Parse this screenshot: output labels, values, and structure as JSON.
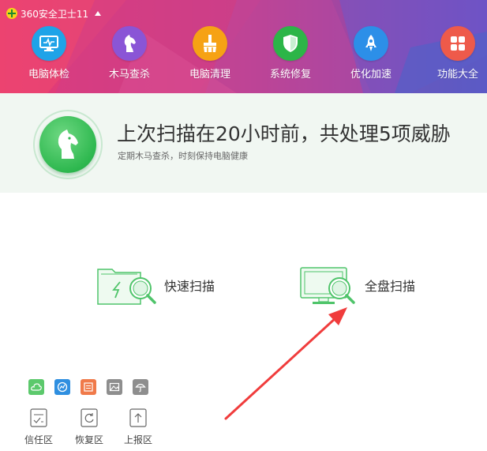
{
  "app": {
    "title": "360安全卫士11"
  },
  "nav": {
    "items": [
      {
        "label": "电脑体检",
        "icon": "monitor-check-icon",
        "color": "#1fa3e8"
      },
      {
        "label": "木马查杀",
        "icon": "horse-icon",
        "color": "#8a55d6"
      },
      {
        "label": "电脑清理",
        "icon": "broom-icon",
        "color": "#f6a214"
      },
      {
        "label": "系统修复",
        "icon": "shield-check-icon",
        "color": "#2cb548"
      },
      {
        "label": "优化加速",
        "icon": "rocket-icon",
        "color": "#2c8fe8"
      },
      {
        "label": "功能大全",
        "icon": "grid-icon",
        "color": "#ee5a4a"
      }
    ]
  },
  "status": {
    "title": "上次扫描在20小时前，共处理5项威胁",
    "subtitle": "定期木马查杀，时刻保持电脑健康"
  },
  "scan": {
    "quick_label": "快速扫描",
    "full_label": "全盘扫描"
  },
  "tools": [
    {
      "icon": "cloud-icon",
      "color": "#5cc96c"
    },
    {
      "icon": "browser-icon",
      "color": "#2f8fe0"
    },
    {
      "icon": "document-icon",
      "color": "#f07a4a"
    },
    {
      "icon": "image-icon",
      "color": "#8e8e8e"
    },
    {
      "icon": "umbrella-icon",
      "color": "#8e8e8e"
    }
  ],
  "zones": [
    {
      "label": "信任区",
      "icon": "trust-icon"
    },
    {
      "label": "恢复区",
      "icon": "restore-icon"
    },
    {
      "label": "上报区",
      "icon": "upload-icon"
    }
  ],
  "colors": {
    "accent_green": "#2eb84f",
    "annotation_red": "#f03c3c"
  }
}
